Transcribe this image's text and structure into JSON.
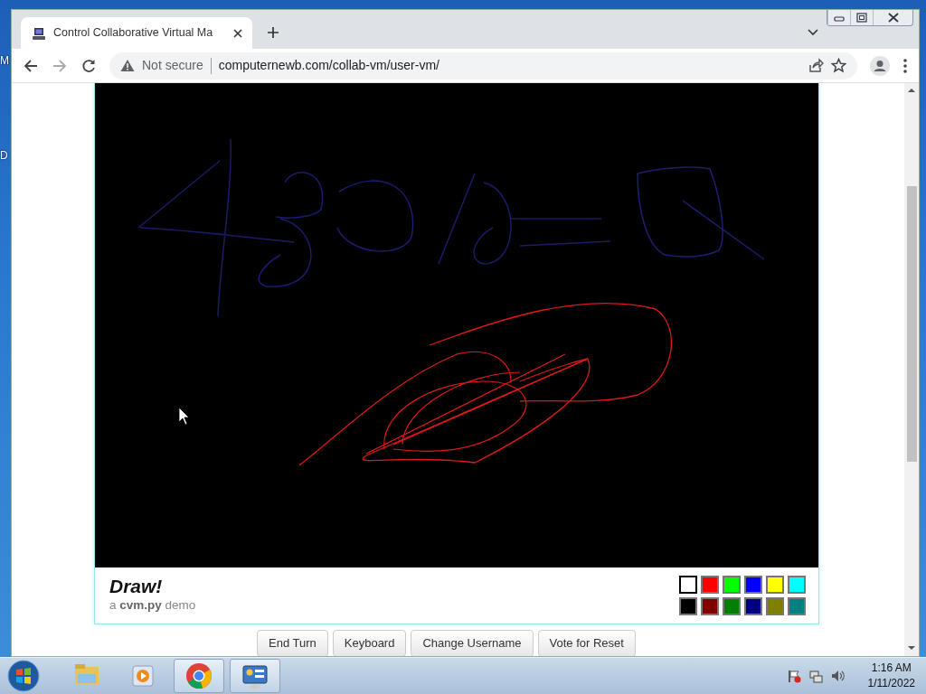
{
  "desktop": {
    "icon_labels": [
      "M",
      "D"
    ]
  },
  "browser": {
    "tab": {
      "title": "Control Collaborative Virtual Ma",
      "selected": true
    },
    "address": {
      "security": "Not secure",
      "url": "computernewb.com/collab-vm/user-vm/"
    }
  },
  "vm": {
    "title": "Draw!",
    "subtitle": "a **cvm.py** demo",
    "palette": [
      {
        "color": "#ffffff",
        "selected": true
      },
      {
        "color": "#ff0000",
        "selected": false
      },
      {
        "color": "#00ff00",
        "selected": false
      },
      {
        "color": "#0000ff",
        "selected": false
      },
      {
        "color": "#ffff00",
        "selected": false
      },
      {
        "color": "#00ffff",
        "selected": false
      },
      {
        "color": "#000000",
        "selected": false
      },
      {
        "color": "#800000",
        "selected": false
      },
      {
        "color": "#008000",
        "selected": false
      },
      {
        "color": "#000080",
        "selected": false
      },
      {
        "color": "#808000",
        "selected": false
      },
      {
        "color": "#008080",
        "selected": false
      }
    ]
  },
  "vm_buttons": [
    "End Turn",
    "Keyboard",
    "Change Username",
    "Vote for Reset"
  ],
  "taskbar": {
    "time": "1:16 AM",
    "date": "1/11/2022"
  }
}
